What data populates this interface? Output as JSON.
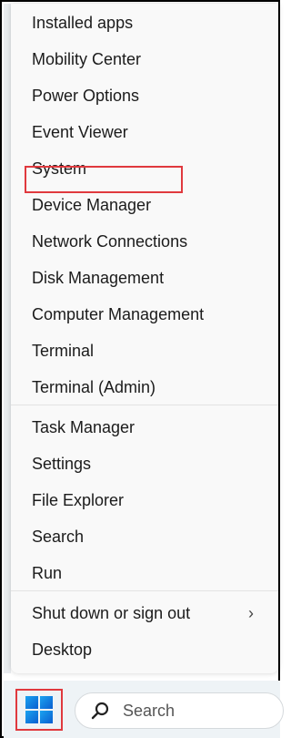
{
  "menu": {
    "items": [
      {
        "label": "Installed apps"
      },
      {
        "label": "Mobility Center"
      },
      {
        "label": "Power Options"
      },
      {
        "label": "Event Viewer"
      },
      {
        "label": "System"
      },
      {
        "label": "Device Manager"
      },
      {
        "label": "Network Connections"
      },
      {
        "label": "Disk Management"
      },
      {
        "label": "Computer Management"
      },
      {
        "label": "Terminal"
      },
      {
        "label": "Terminal (Admin)"
      },
      {
        "label": "Task Manager"
      },
      {
        "label": "Settings"
      },
      {
        "label": "File Explorer"
      },
      {
        "label": "Search"
      },
      {
        "label": "Run"
      },
      {
        "label": "Shut down or sign out",
        "has_submenu": true,
        "chevron": "›"
      },
      {
        "label": "Desktop"
      }
    ],
    "highlighted_item": "Device Manager"
  },
  "taskbar": {
    "start_icon": "windows-logo-icon",
    "search": {
      "placeholder": "Search",
      "icon": "search-icon"
    }
  },
  "colors": {
    "highlight": "#e0393e",
    "windows_blue": "#0a6fd8",
    "menu_bg": "#f9f9f9",
    "taskbar_bg": "#eef3f6"
  }
}
